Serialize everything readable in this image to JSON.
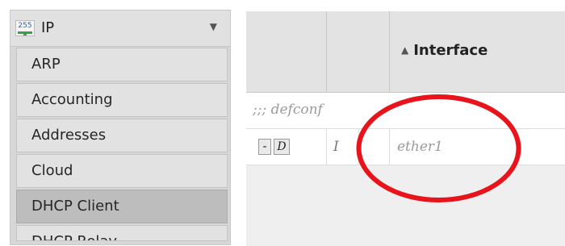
{
  "sidebar": {
    "section": {
      "icon_name": "ip-network-icon",
      "icon_text": "255",
      "label": "IP",
      "arrow": "▼"
    },
    "items": [
      {
        "label": "ARP",
        "active": false
      },
      {
        "label": "Accounting",
        "active": false
      },
      {
        "label": "Addresses",
        "active": false
      },
      {
        "label": "Cloud",
        "active": false
      },
      {
        "label": "DHCP Client",
        "active": true
      },
      {
        "label": "DHCP Relay",
        "active": false
      }
    ]
  },
  "table": {
    "columns": [
      {
        "label": ""
      },
      {
        "label": ""
      },
      {
        "label": "Interface",
        "sort_icon": "▲"
      }
    ],
    "comment": ";;; defconf",
    "rows": [
      {
        "remove_button": "-",
        "disable_button": "D",
        "flag": "I",
        "interface": "ether1"
      }
    ]
  },
  "colors": {
    "highlight": "#e8141c",
    "sidebar_bg": "#d7d7d7",
    "header_bg": "#e3e3e3",
    "active_item": "#bdbdbd"
  }
}
